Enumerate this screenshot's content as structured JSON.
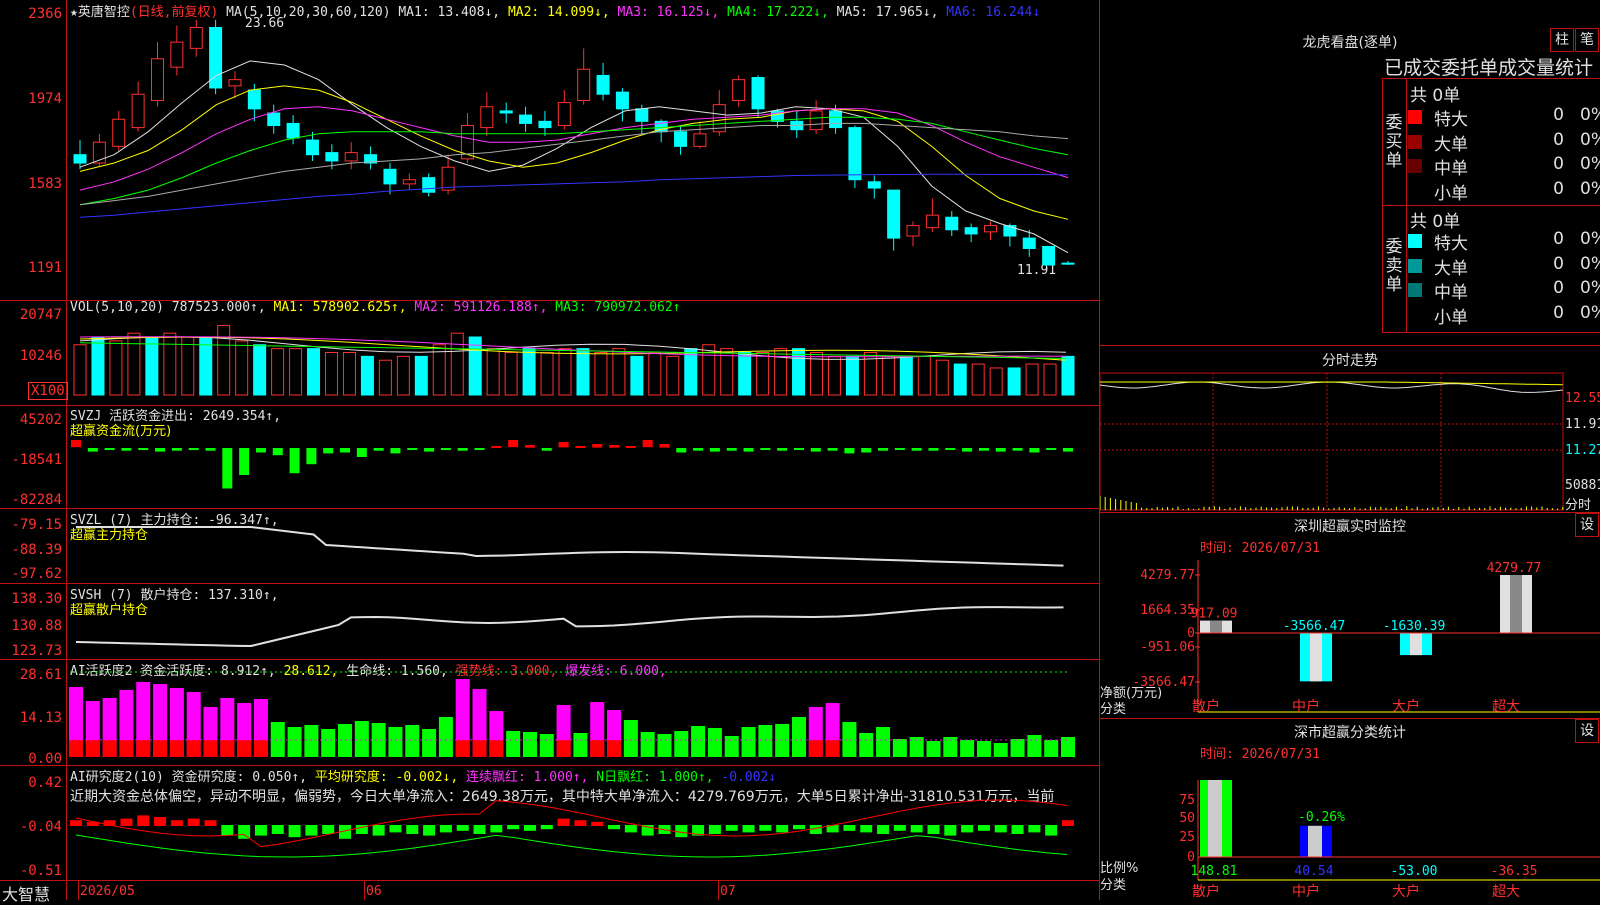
{
  "stock": {
    "name": "英唐智控",
    "mode": "(日线,前复权)",
    "star": "★"
  },
  "main": {
    "ma_label": "MA(5,10,20,30,60,120)",
    "ma1": "MA1: 13.408↓,",
    "ma2": "MA2: 14.099↓,",
    "ma3": "MA3: 16.125↓,",
    "ma4": "MA4: 17.222↓,",
    "ma5": "MA5: 17.965↓,",
    "ma6": "MA6: 16.244↓",
    "high_mark": "23.66",
    "low_mark": "11.91",
    "y_ticks": [
      "2366",
      "1974",
      "1583",
      "1191"
    ]
  },
  "vol": {
    "label": "VOL(5,10,20)",
    "v": "787523.000↑,",
    "ma1": "MA1: 578902.625↑,",
    "ma2": "MA2: 591126.188↑,",
    "ma3": "MA3: 790972.062↑",
    "y_ticks": [
      "20747",
      "10246"
    ],
    "unit": "X100"
  },
  "svzj": {
    "label": "SVZJ  活跃资金进出: 2649.354↑,",
    "sub": "超赢资金流(万元)",
    "y_ticks": [
      "45202",
      "-18541",
      "-82284"
    ]
  },
  "svzl": {
    "label": "SVZL (7) 主力持仓: -96.347↑,",
    "sub": "超赢主力持仓",
    "y_ticks": [
      "-79.15",
      "-88.39",
      "-97.62"
    ]
  },
  "svsh": {
    "label": "SVSH (7) 散户持仓: 137.310↑,",
    "sub": "超赢散户持仓",
    "y_ticks": [
      "138.30",
      "130.88",
      "123.73"
    ]
  },
  "ai1": {
    "label": "AI活跃度2 资金活跃度: 8.912↑,",
    "v2": "28.612,",
    "life": "生命线: 1.560,",
    "strong": "强势线: 3.000,",
    "burst": "爆发线: 6.000,",
    "y_ticks": [
      "28.61",
      "14.13",
      "0.00"
    ]
  },
  "ai2": {
    "label": "AI研究度2(10) 资金研究度: 0.050↑,",
    "avg": "平均研究度: -0.002↓,",
    "cont": "连续飘红: 1.000↑,",
    "nday": "N日飘红: 1.000↑,",
    "last": "-0.002↓",
    "y_ticks": [
      "0.42",
      "-0.04",
      "-0.51"
    ],
    "desc": "近期大资金总体偏空，异动不明显，偏弱势，今日大单净流入：2649.38万元，其中特大单净流入：4279.769万元，大单5日累计净出-31810.531万元，当前"
  },
  "xaxis": {
    "logo": "大智慧",
    "m1": "2026/05",
    "m2": "06",
    "m3": "07"
  },
  "lhb": {
    "title": "龙虎看盘(逐单)",
    "btn1": "柱",
    "btn2": "笔",
    "subtitle": "已成交委托单成交量统计",
    "buy": {
      "side": "委买单",
      "total": "共 0单",
      "rows": [
        {
          "name": "特大",
          "n": "0",
          "p": "0%",
          "c": "#ff0000"
        },
        {
          "name": "大单",
          "n": "0",
          "p": "0%",
          "c": "#990000"
        },
        {
          "name": "中单",
          "n": "0",
          "p": "0%",
          "c": "#660000"
        },
        {
          "name": "小单",
          "n": "0",
          "p": "0%",
          "c": "#000000"
        }
      ]
    },
    "sell": {
      "side": "委卖单",
      "total": "共 0单",
      "rows": [
        {
          "name": "特大",
          "n": "0",
          "p": "0%",
          "c": "#00ffff"
        },
        {
          "name": "大单",
          "n": "0",
          "p": "0%",
          "c": "#009999"
        },
        {
          "name": "中单",
          "n": "0",
          "p": "0%",
          "c": "#007777"
        },
        {
          "name": "小单",
          "n": "0",
          "p": "0%",
          "c": "#000000"
        }
      ]
    }
  },
  "fenshi": {
    "title": "分时走势",
    "y1": "12.55",
    "y2": "11.91",
    "y3": "11.27",
    "vol": "50881",
    "vol_lbl": "分时"
  },
  "monitor": {
    "title": "深圳超赢实时监控",
    "set": "设",
    "time": "时间: 2026/07/31",
    "y_ticks": [
      "4279.77",
      "1664.35",
      "0",
      "-951.06",
      "-3566.47"
    ],
    "ylabel": "净额(万元)",
    "xlabel": "分类",
    "cats": [
      "散户",
      "中户",
      "大户",
      "超大"
    ],
    "values": [
      "917.09",
      "-3566.47",
      "-1630.39",
      "4279.77"
    ]
  },
  "stats": {
    "title": "深市超赢分类统计",
    "set": "设",
    "time": "时间: 2026/07/31",
    "y_ticks": [
      "75",
      "50",
      "25",
      "0"
    ],
    "ylabel": "比例%",
    "xlabel": "分类",
    "cats": [
      "散户",
      "中户",
      "大户",
      "超大"
    ],
    "values": [
      "148.81",
      "40.54",
      "-53.00",
      "-36.35"
    ],
    "pct": "-0.26%"
  }
}
